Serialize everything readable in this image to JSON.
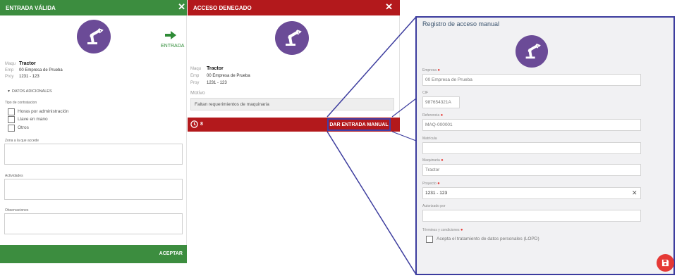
{
  "valid_panel": {
    "title": "ENTRADA VÁLIDA",
    "entry_label": "ENTRADA",
    "fields": [
      {
        "key": "Maqu",
        "value": "Tractor"
      },
      {
        "key": "Emp",
        "value": "00 Empresa de Prueba"
      },
      {
        "key": "Proy",
        "value": "1231 - 123"
      }
    ],
    "additional_toggle": "DATOS ADICIONALES",
    "contract_type_label": "Tipo de contratacion",
    "contract_options": [
      "Horas por administración",
      "Llave en mano",
      "Otros"
    ],
    "zone_label": "Zona a la que accede",
    "activities_label": "Actividades",
    "observations_label": "Observaciones",
    "accept_label": "ACEPTAR",
    "colors": {
      "header": "#3c8d3f"
    }
  },
  "denied_panel": {
    "title": "ACCESO DENEGADO",
    "fields": [
      {
        "key": "Maqu",
        "value": "Tractor"
      },
      {
        "key": "Emp",
        "value": "00 Empresa de Prueba"
      },
      {
        "key": "Proy",
        "value": "1231 - 123"
      }
    ],
    "reason_label": "Motivo",
    "reason_value": "Faltan requerimientos de maquinaria",
    "timer": "8",
    "manual_button": "DAR ENTRADA MANUAL",
    "colors": {
      "header": "#b3191c"
    }
  },
  "manual_panel": {
    "title": "Registro de acceso manual",
    "fields": [
      {
        "label": "Empresa",
        "required": true,
        "value": "00 Empresa de Prueba"
      },
      {
        "label": "CIF",
        "required": false,
        "value": "987654321A"
      },
      {
        "label": "Referencia",
        "required": true,
        "value": "MAQ-000001"
      },
      {
        "label": "Matrícula",
        "required": false,
        "value": ""
      },
      {
        "label": "Maquinaria",
        "required": true,
        "value": "Tractor"
      },
      {
        "label": "Proyecto",
        "required": true,
        "value": "1231 - 123"
      },
      {
        "label": "Autorizado por",
        "required": false,
        "value": ""
      }
    ],
    "terms_label": "Términos y condiciones",
    "terms_checkbox": "Acepta el tratamiento de datos personales (LOPD)",
    "colors": {
      "border": "#3c3c9e",
      "fab": "#e53935"
    }
  },
  "icons": [
    "robot-arm-icon",
    "close-icon",
    "arrow-right-icon",
    "chevron-down-icon",
    "clock-icon",
    "save-icon",
    "clear-icon"
  ]
}
